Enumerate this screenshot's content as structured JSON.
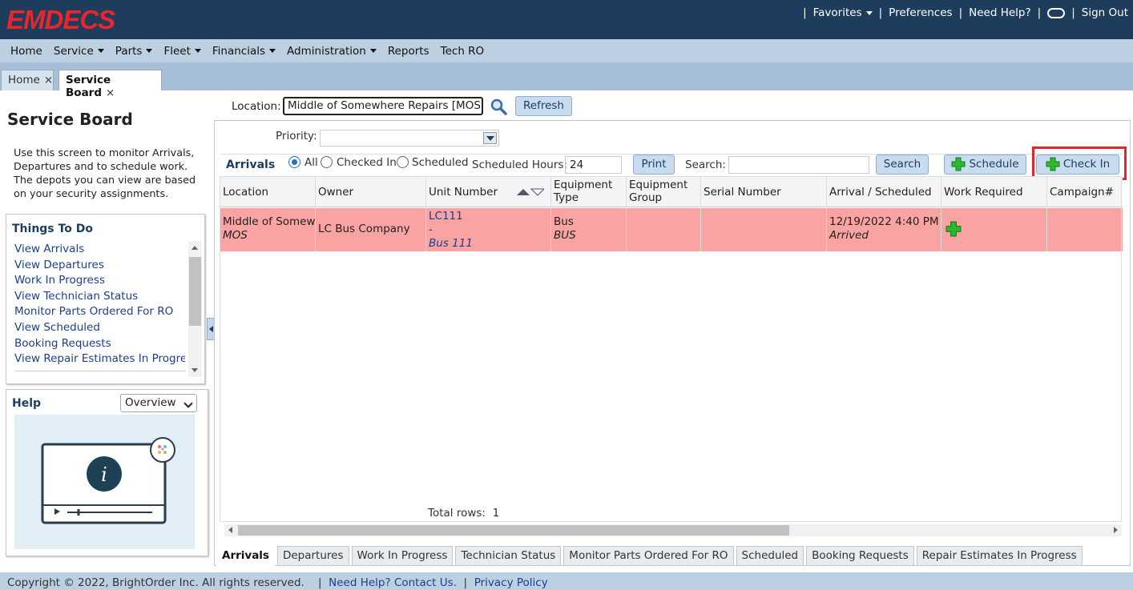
{
  "app": {
    "logo": "EMDECS"
  },
  "topnav": {
    "favorites": "Favorites",
    "preferences": "Preferences",
    "need_help": "Need Help?",
    "sign_out": "Sign Out",
    "separator": "|"
  },
  "menu": [
    {
      "label": "Home",
      "dropdown": false
    },
    {
      "label": "Service",
      "dropdown": true
    },
    {
      "label": "Parts",
      "dropdown": true
    },
    {
      "label": "Fleet",
      "dropdown": true
    },
    {
      "label": "Financials",
      "dropdown": true
    },
    {
      "label": "Administration",
      "dropdown": true
    },
    {
      "label": "Reports",
      "dropdown": false
    },
    {
      "label": "Tech RO",
      "dropdown": false
    }
  ],
  "tabs": {
    "home": "Home",
    "service_board": "Service Board",
    "close": "×"
  },
  "sidebar": {
    "title": "Service Board",
    "intro": "Use this screen to monitor Arrivals, Departures and to schedule work. The depots you can view are based on your security assignments.",
    "todo_title": "Things To Do",
    "todo_items": [
      "View Arrivals",
      "View Departures",
      "Work In Progress",
      "View Technician Status",
      "Monitor Parts Ordered For RO",
      "View Scheduled",
      "Booking Requests",
      "View Repair Estimates In Progress"
    ],
    "help_title": "Help",
    "help_select": "Overview"
  },
  "filters": {
    "location_label": "Location:",
    "location_value": "Middle of Somewhere Repairs [MOS]",
    "refresh": "Refresh",
    "priority_label": "Priority:"
  },
  "toolbar": {
    "title": "Arrivals",
    "radio_all": "All",
    "radio_checked_in": "Checked In",
    "radio_scheduled": "Scheduled",
    "scheduled_hours_label": "Scheduled Hours:",
    "scheduled_hours_value": "24",
    "print": "Print",
    "search_label": "Search:",
    "search_button": "Search",
    "schedule": "Schedule",
    "check_in": "Check In"
  },
  "grid": {
    "columns": [
      "Location",
      "Owner",
      "Unit Number",
      "Equipment Type",
      "Equipment Group",
      "Serial Number",
      "Arrival / Scheduled",
      "Work Required",
      "Campaign#"
    ],
    "columns_split": {
      "equip_type_1": "Equipment",
      "equip_type_2": "Type",
      "equip_group_1": "Equipment",
      "equip_group_2": "Group"
    },
    "rows": [
      {
        "location": "Middle of Somewhere Repairs",
        "location_code": "MOS",
        "owner": "LC Bus Company",
        "unit": "LC111",
        "unit_dash": "-",
        "unit_desc": "Bus 111",
        "equip_type": "Bus",
        "equip_type_code": "BUS",
        "equip_group": "",
        "serial": "",
        "arrival": "12/19/2022 4:40 PM",
        "arrival_status": "Arrived",
        "campaign": ""
      }
    ],
    "total_label": "Total rows:",
    "total_value": "1"
  },
  "bottom_tabs": [
    "Arrivals",
    "Departures",
    "Work In Progress",
    "Technician Status",
    "Monitor Parts Ordered For RO",
    "Scheduled",
    "Booking Requests",
    "Repair Estimates In Progress"
  ],
  "footer": {
    "copyright": "Copyright © 2022, BrightOrder Inc. All rights reserved.",
    "contact": "Need Help? Contact Us.",
    "privacy": "Privacy Policy"
  },
  "colors": {
    "header": "#1e3d5c",
    "logo": "#e8262b",
    "row_highlight": "#f9a3a3",
    "link": "#1c3f8c",
    "callout": "#e3262b"
  }
}
